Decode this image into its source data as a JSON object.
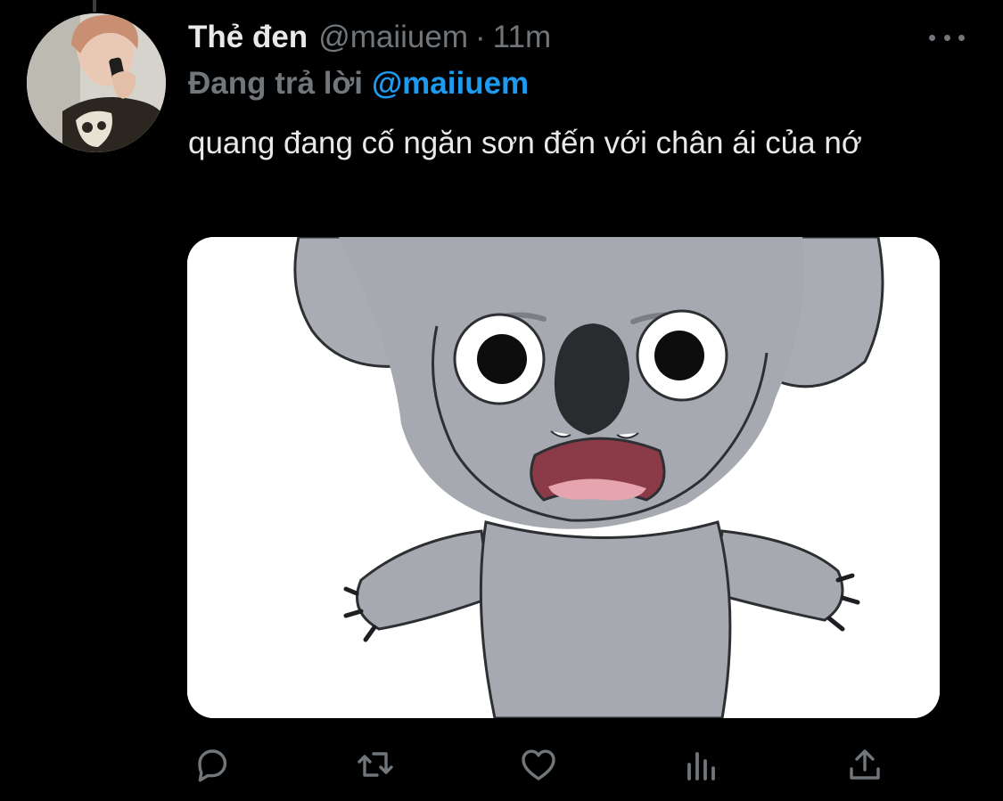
{
  "tweet": {
    "display_name": "Thẻ đen",
    "handle": "@maiiuem",
    "separator": "·",
    "time": "11m",
    "reply_prefix": "Đang trả lời",
    "reply_mention": "@maiiuem",
    "text": "quang đang cố ngăn sơn đến với chân ái của nớ"
  },
  "actions": [
    {
      "icon": "reply-icon"
    },
    {
      "icon": "retweet-icon"
    },
    {
      "icon": "like-icon"
    },
    {
      "icon": "analytics-icon"
    },
    {
      "icon": "share-icon"
    }
  ],
  "colors": {
    "background": "#000000",
    "text_primary": "#e7e9ea",
    "text_secondary": "#71767b",
    "accent": "#1d9bf0"
  }
}
